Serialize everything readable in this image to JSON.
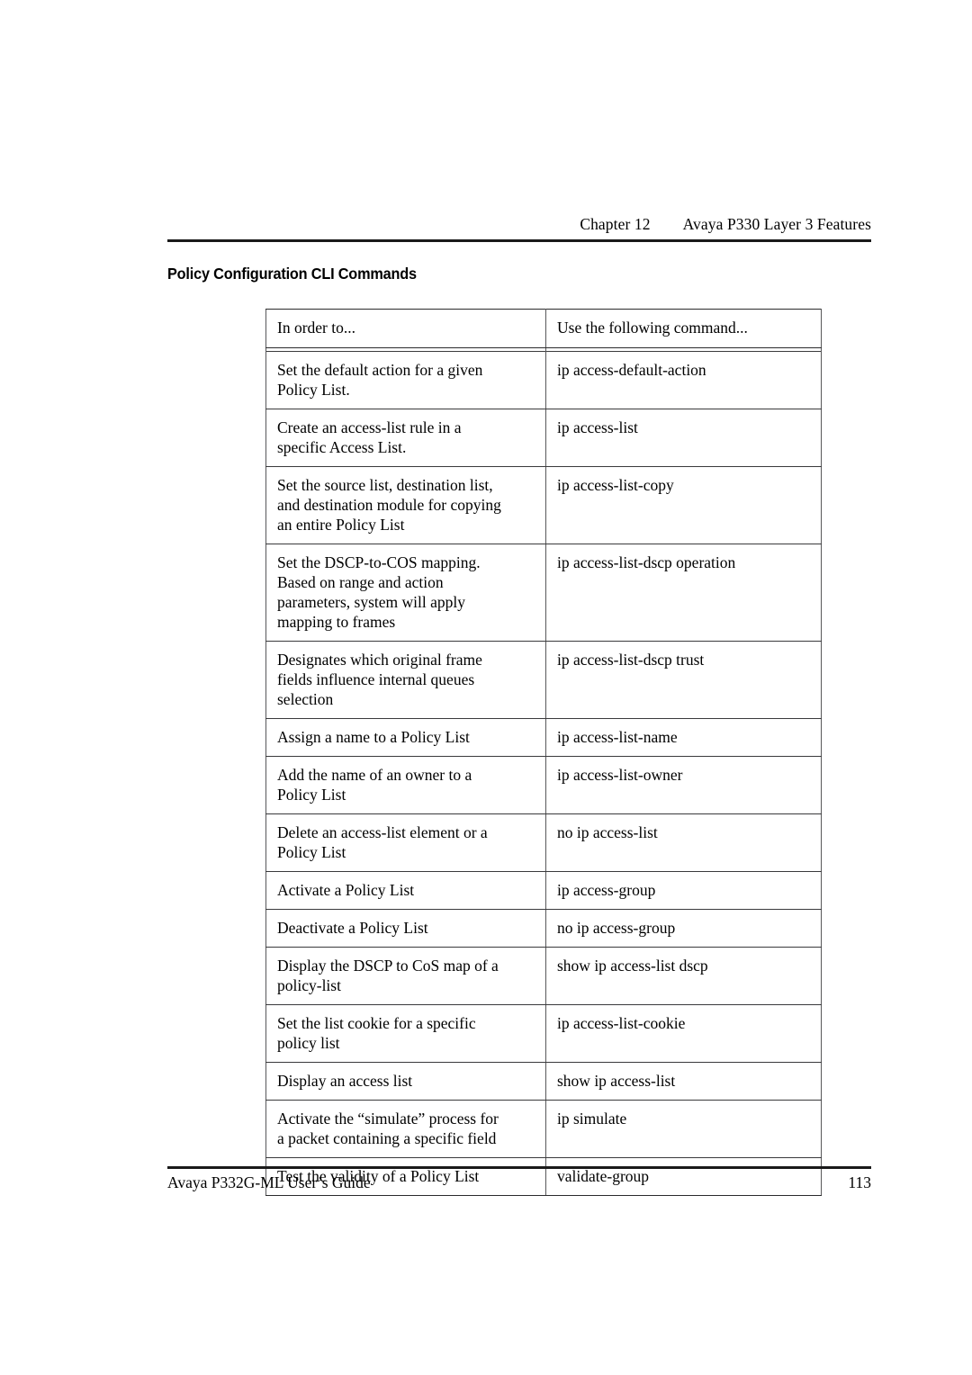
{
  "header": {
    "chapter": "Chapter 12",
    "chapter_title": "Avaya P330 Layer 3 Features"
  },
  "section": {
    "title": "Policy Configuration CLI Commands"
  },
  "table": {
    "columns": [
      "In order to...",
      "Use the following command..."
    ],
    "rows": [
      {
        "action": [
          "Set the default action for a given",
          "Policy List."
        ],
        "command": [
          "ip access-default-action"
        ]
      },
      {
        "action": [
          "Create an access-list rule in a",
          "specific Access List."
        ],
        "command": [
          "ip access-list"
        ]
      },
      {
        "action": [
          "Set the source list, destination list,",
          "and destination module for copying",
          "an entire Policy List"
        ],
        "command": [
          "ip access-list-copy"
        ]
      },
      {
        "action": [
          "Set the DSCP-to-COS mapping.",
          "Based on range and action",
          "parameters, system will apply",
          "mapping to frames"
        ],
        "command": [
          "ip access-list-dscp operation"
        ]
      },
      {
        "action": [
          "Designates which original frame",
          "fields influence internal queues",
          "selection"
        ],
        "command": [
          "ip access-list-dscp trust"
        ]
      },
      {
        "action": [
          "Assign a name to a Policy List"
        ],
        "command": [
          "ip access-list-name"
        ]
      },
      {
        "action": [
          "Add the name of an owner to a",
          "Policy List"
        ],
        "command": [
          "ip access-list-owner"
        ]
      },
      {
        "action": [
          "Delete an access-list element or a",
          "Policy List"
        ],
        "command": [
          "no ip access-list"
        ]
      },
      {
        "action": [
          "Activate a Policy List"
        ],
        "command": [
          "ip access-group"
        ]
      },
      {
        "action": [
          "Deactivate a Policy List"
        ],
        "command": [
          "no ip access-group"
        ]
      },
      {
        "action": [
          "Display the DSCP to CoS map of a",
          "policy-list"
        ],
        "command": [
          "show ip access-list dscp"
        ]
      },
      {
        "action": [
          "Set the list cookie for a specific",
          "policy list"
        ],
        "command": [
          "ip access-list-cookie"
        ]
      },
      {
        "action": [
          "Display an access list"
        ],
        "command": [
          "show ip access-list"
        ]
      },
      {
        "action": [
          "Activate the “simulate” process for",
          "a packet containing a specific field"
        ],
        "command": [
          "ip simulate"
        ]
      },
      {
        "action": [
          "Test the validity of a Policy List"
        ],
        "command": [
          "validate-group"
        ]
      }
    ]
  },
  "footer": {
    "guide_title": "Avaya P332G-ML User’s Guide",
    "page_number": "113"
  }
}
